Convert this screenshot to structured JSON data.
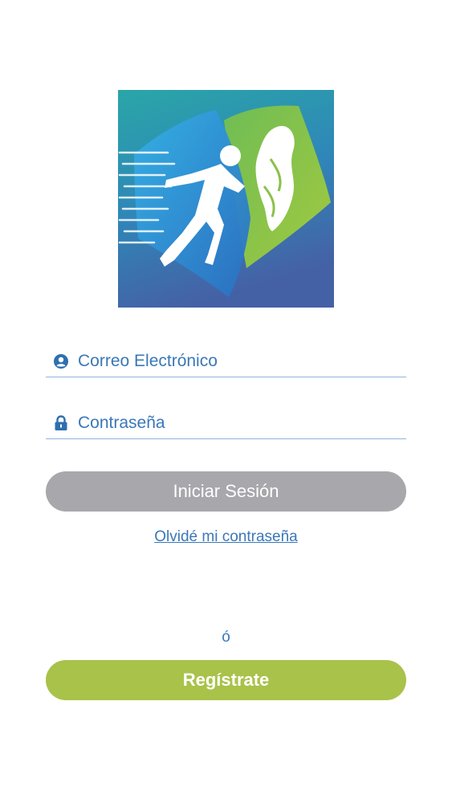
{
  "logo": {
    "name": "runner-app-logo",
    "colors": {
      "bg_top": "#2aa6a8",
      "bg_bottom": "#3f6aa8",
      "blue_shape": "#2f8fd4",
      "green_shape": "#8cc04a",
      "figure": "#ffffff"
    }
  },
  "login": {
    "email_placeholder": "Correo Electrónico",
    "email_value": "",
    "email_icon": "user-icon",
    "password_placeholder": "Contraseña",
    "password_value": "",
    "password_icon": "lock-icon",
    "submit_label": "Iniciar Sesión",
    "forgot_label": "Olvidé mi contraseña"
  },
  "separator": "ó",
  "register": {
    "label": "Regístrate"
  },
  "colors": {
    "accent": "#3a78b8",
    "login_button": "#a8a7ac",
    "register_button": "#a9c24a"
  }
}
